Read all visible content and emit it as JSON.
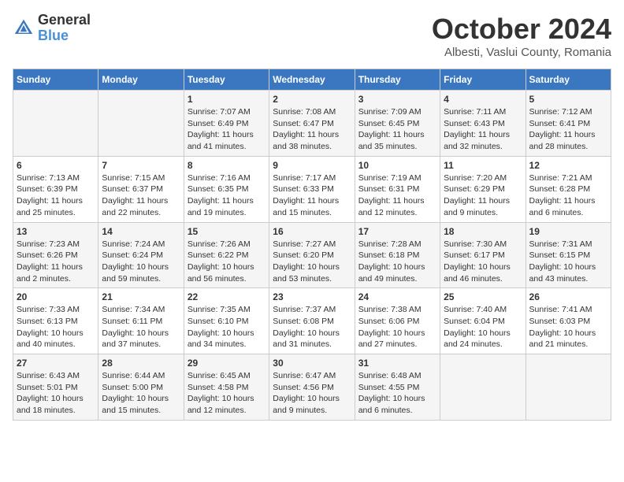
{
  "header": {
    "logo_line1": "General",
    "logo_line2": "Blue",
    "month": "October 2024",
    "location": "Albesti, Vaslui County, Romania"
  },
  "days_of_week": [
    "Sunday",
    "Monday",
    "Tuesday",
    "Wednesday",
    "Thursday",
    "Friday",
    "Saturday"
  ],
  "weeks": [
    [
      {
        "day": "",
        "info": ""
      },
      {
        "day": "",
        "info": ""
      },
      {
        "day": "1",
        "info": "Sunrise: 7:07 AM\nSunset: 6:49 PM\nDaylight: 11 hours and 41 minutes."
      },
      {
        "day": "2",
        "info": "Sunrise: 7:08 AM\nSunset: 6:47 PM\nDaylight: 11 hours and 38 minutes."
      },
      {
        "day": "3",
        "info": "Sunrise: 7:09 AM\nSunset: 6:45 PM\nDaylight: 11 hours and 35 minutes."
      },
      {
        "day": "4",
        "info": "Sunrise: 7:11 AM\nSunset: 6:43 PM\nDaylight: 11 hours and 32 minutes."
      },
      {
        "day": "5",
        "info": "Sunrise: 7:12 AM\nSunset: 6:41 PM\nDaylight: 11 hours and 28 minutes."
      }
    ],
    [
      {
        "day": "6",
        "info": "Sunrise: 7:13 AM\nSunset: 6:39 PM\nDaylight: 11 hours and 25 minutes."
      },
      {
        "day": "7",
        "info": "Sunrise: 7:15 AM\nSunset: 6:37 PM\nDaylight: 11 hours and 22 minutes."
      },
      {
        "day": "8",
        "info": "Sunrise: 7:16 AM\nSunset: 6:35 PM\nDaylight: 11 hours and 19 minutes."
      },
      {
        "day": "9",
        "info": "Sunrise: 7:17 AM\nSunset: 6:33 PM\nDaylight: 11 hours and 15 minutes."
      },
      {
        "day": "10",
        "info": "Sunrise: 7:19 AM\nSunset: 6:31 PM\nDaylight: 11 hours and 12 minutes."
      },
      {
        "day": "11",
        "info": "Sunrise: 7:20 AM\nSunset: 6:29 PM\nDaylight: 11 hours and 9 minutes."
      },
      {
        "day": "12",
        "info": "Sunrise: 7:21 AM\nSunset: 6:28 PM\nDaylight: 11 hours and 6 minutes."
      }
    ],
    [
      {
        "day": "13",
        "info": "Sunrise: 7:23 AM\nSunset: 6:26 PM\nDaylight: 11 hours and 2 minutes."
      },
      {
        "day": "14",
        "info": "Sunrise: 7:24 AM\nSunset: 6:24 PM\nDaylight: 10 hours and 59 minutes."
      },
      {
        "day": "15",
        "info": "Sunrise: 7:26 AM\nSunset: 6:22 PM\nDaylight: 10 hours and 56 minutes."
      },
      {
        "day": "16",
        "info": "Sunrise: 7:27 AM\nSunset: 6:20 PM\nDaylight: 10 hours and 53 minutes."
      },
      {
        "day": "17",
        "info": "Sunrise: 7:28 AM\nSunset: 6:18 PM\nDaylight: 10 hours and 49 minutes."
      },
      {
        "day": "18",
        "info": "Sunrise: 7:30 AM\nSunset: 6:17 PM\nDaylight: 10 hours and 46 minutes."
      },
      {
        "day": "19",
        "info": "Sunrise: 7:31 AM\nSunset: 6:15 PM\nDaylight: 10 hours and 43 minutes."
      }
    ],
    [
      {
        "day": "20",
        "info": "Sunrise: 7:33 AM\nSunset: 6:13 PM\nDaylight: 10 hours and 40 minutes."
      },
      {
        "day": "21",
        "info": "Sunrise: 7:34 AM\nSunset: 6:11 PM\nDaylight: 10 hours and 37 minutes."
      },
      {
        "day": "22",
        "info": "Sunrise: 7:35 AM\nSunset: 6:10 PM\nDaylight: 10 hours and 34 minutes."
      },
      {
        "day": "23",
        "info": "Sunrise: 7:37 AM\nSunset: 6:08 PM\nDaylight: 10 hours and 31 minutes."
      },
      {
        "day": "24",
        "info": "Sunrise: 7:38 AM\nSunset: 6:06 PM\nDaylight: 10 hours and 27 minutes."
      },
      {
        "day": "25",
        "info": "Sunrise: 7:40 AM\nSunset: 6:04 PM\nDaylight: 10 hours and 24 minutes."
      },
      {
        "day": "26",
        "info": "Sunrise: 7:41 AM\nSunset: 6:03 PM\nDaylight: 10 hours and 21 minutes."
      }
    ],
    [
      {
        "day": "27",
        "info": "Sunrise: 6:43 AM\nSunset: 5:01 PM\nDaylight: 10 hours and 18 minutes."
      },
      {
        "day": "28",
        "info": "Sunrise: 6:44 AM\nSunset: 5:00 PM\nDaylight: 10 hours and 15 minutes."
      },
      {
        "day": "29",
        "info": "Sunrise: 6:45 AM\nSunset: 4:58 PM\nDaylight: 10 hours and 12 minutes."
      },
      {
        "day": "30",
        "info": "Sunrise: 6:47 AM\nSunset: 4:56 PM\nDaylight: 10 hours and 9 minutes."
      },
      {
        "day": "31",
        "info": "Sunrise: 6:48 AM\nSunset: 4:55 PM\nDaylight: 10 hours and 6 minutes."
      },
      {
        "day": "",
        "info": ""
      },
      {
        "day": "",
        "info": ""
      }
    ]
  ]
}
